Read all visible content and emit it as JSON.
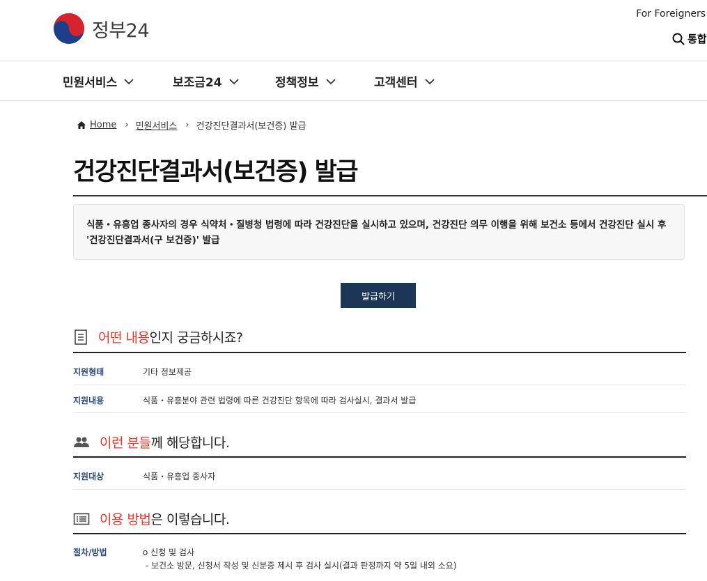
{
  "header": {
    "logo_text": "정부24",
    "foreigners_link": "For Foreigners",
    "search_label": "통합"
  },
  "gnb": {
    "items": [
      {
        "label": "민원서비스"
      },
      {
        "label": "보조금24"
      },
      {
        "label": "정책정보"
      },
      {
        "label": "고객센터"
      }
    ]
  },
  "breadcrumb": {
    "home": "Home",
    "level1": "민원서비스",
    "current": "건강진단결과서(보건증) 발급"
  },
  "page": {
    "title": "건강진단결과서(보건증) 발급",
    "description_line1": "식품・유흥업 종사자의 경우 식약처・질병청 법령에 따라 건강진단을 실시하고 있으며, 건강진단 의무 이행을 위해 보건소 등에서 건강진단 실시 후",
    "description_line2": "'건강진단결과서(구 보건증)' 발급",
    "apply_button": "발급하기"
  },
  "sections": {
    "what": {
      "highlight": "어떤 내용",
      "rest": "인지 궁금하시죠?",
      "rows": [
        {
          "key": "지원형태",
          "value": "기타  정보제공"
        },
        {
          "key": "지원내용",
          "value": "식품・유흥분야 관련 법령에 따른 건강진단 항목에 따라 검사실시, 결과서 발급"
        }
      ]
    },
    "who": {
      "highlight": "이런 분들",
      "rest": "께 해당합니다.",
      "rows": [
        {
          "key": "지원대상",
          "value": "식품・유흥업 종사자"
        }
      ]
    },
    "how": {
      "highlight": "이용 방법",
      "rest": "은 이렇습니다.",
      "rows": [
        {
          "key": "절차/방법",
          "value_line1": "o 신청 및 검사",
          "value_line2": " - 보건소 방문, 신청서 작성 및 신분증 제시 후 검사 실시(결과 판정까지 약 5일 내외 소요)"
        }
      ]
    }
  },
  "colors": {
    "accent_red": "#e63a2e",
    "button_navy": "#1d3557",
    "key_blue": "#2b4a78"
  }
}
